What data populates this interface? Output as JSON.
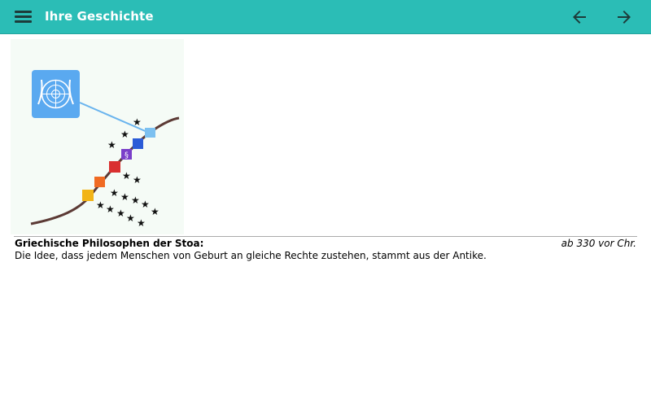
{
  "header": {
    "title": "Ihre Geschichte",
    "menu_icon": "menu-icon",
    "back_icon": "arrow-left-icon",
    "forward_icon": "arrow-right-icon",
    "accent_color": "#2bbdb6"
  },
  "entry": {
    "heading": "Griechische Philosophen der Stoa:",
    "date": "ab 330 vor Chr.",
    "description": "Die Idee, dass jedem Menschen von Geburt an gleiche Rechte zustehen, stammt aus der Antike."
  },
  "timeline_figure": {
    "icons": [
      "un-emblem-icon",
      "dove-icon",
      "handshake-icon",
      "paragraph-icon",
      "scales-icon",
      "torch-icon",
      "tablet-icon"
    ],
    "icon_colors": [
      "#5aa9f0",
      "#7cc0f0",
      "#2a5bd7",
      "#7a3fc9",
      "#d93030",
      "#f06a22",
      "#f2b417"
    ]
  }
}
